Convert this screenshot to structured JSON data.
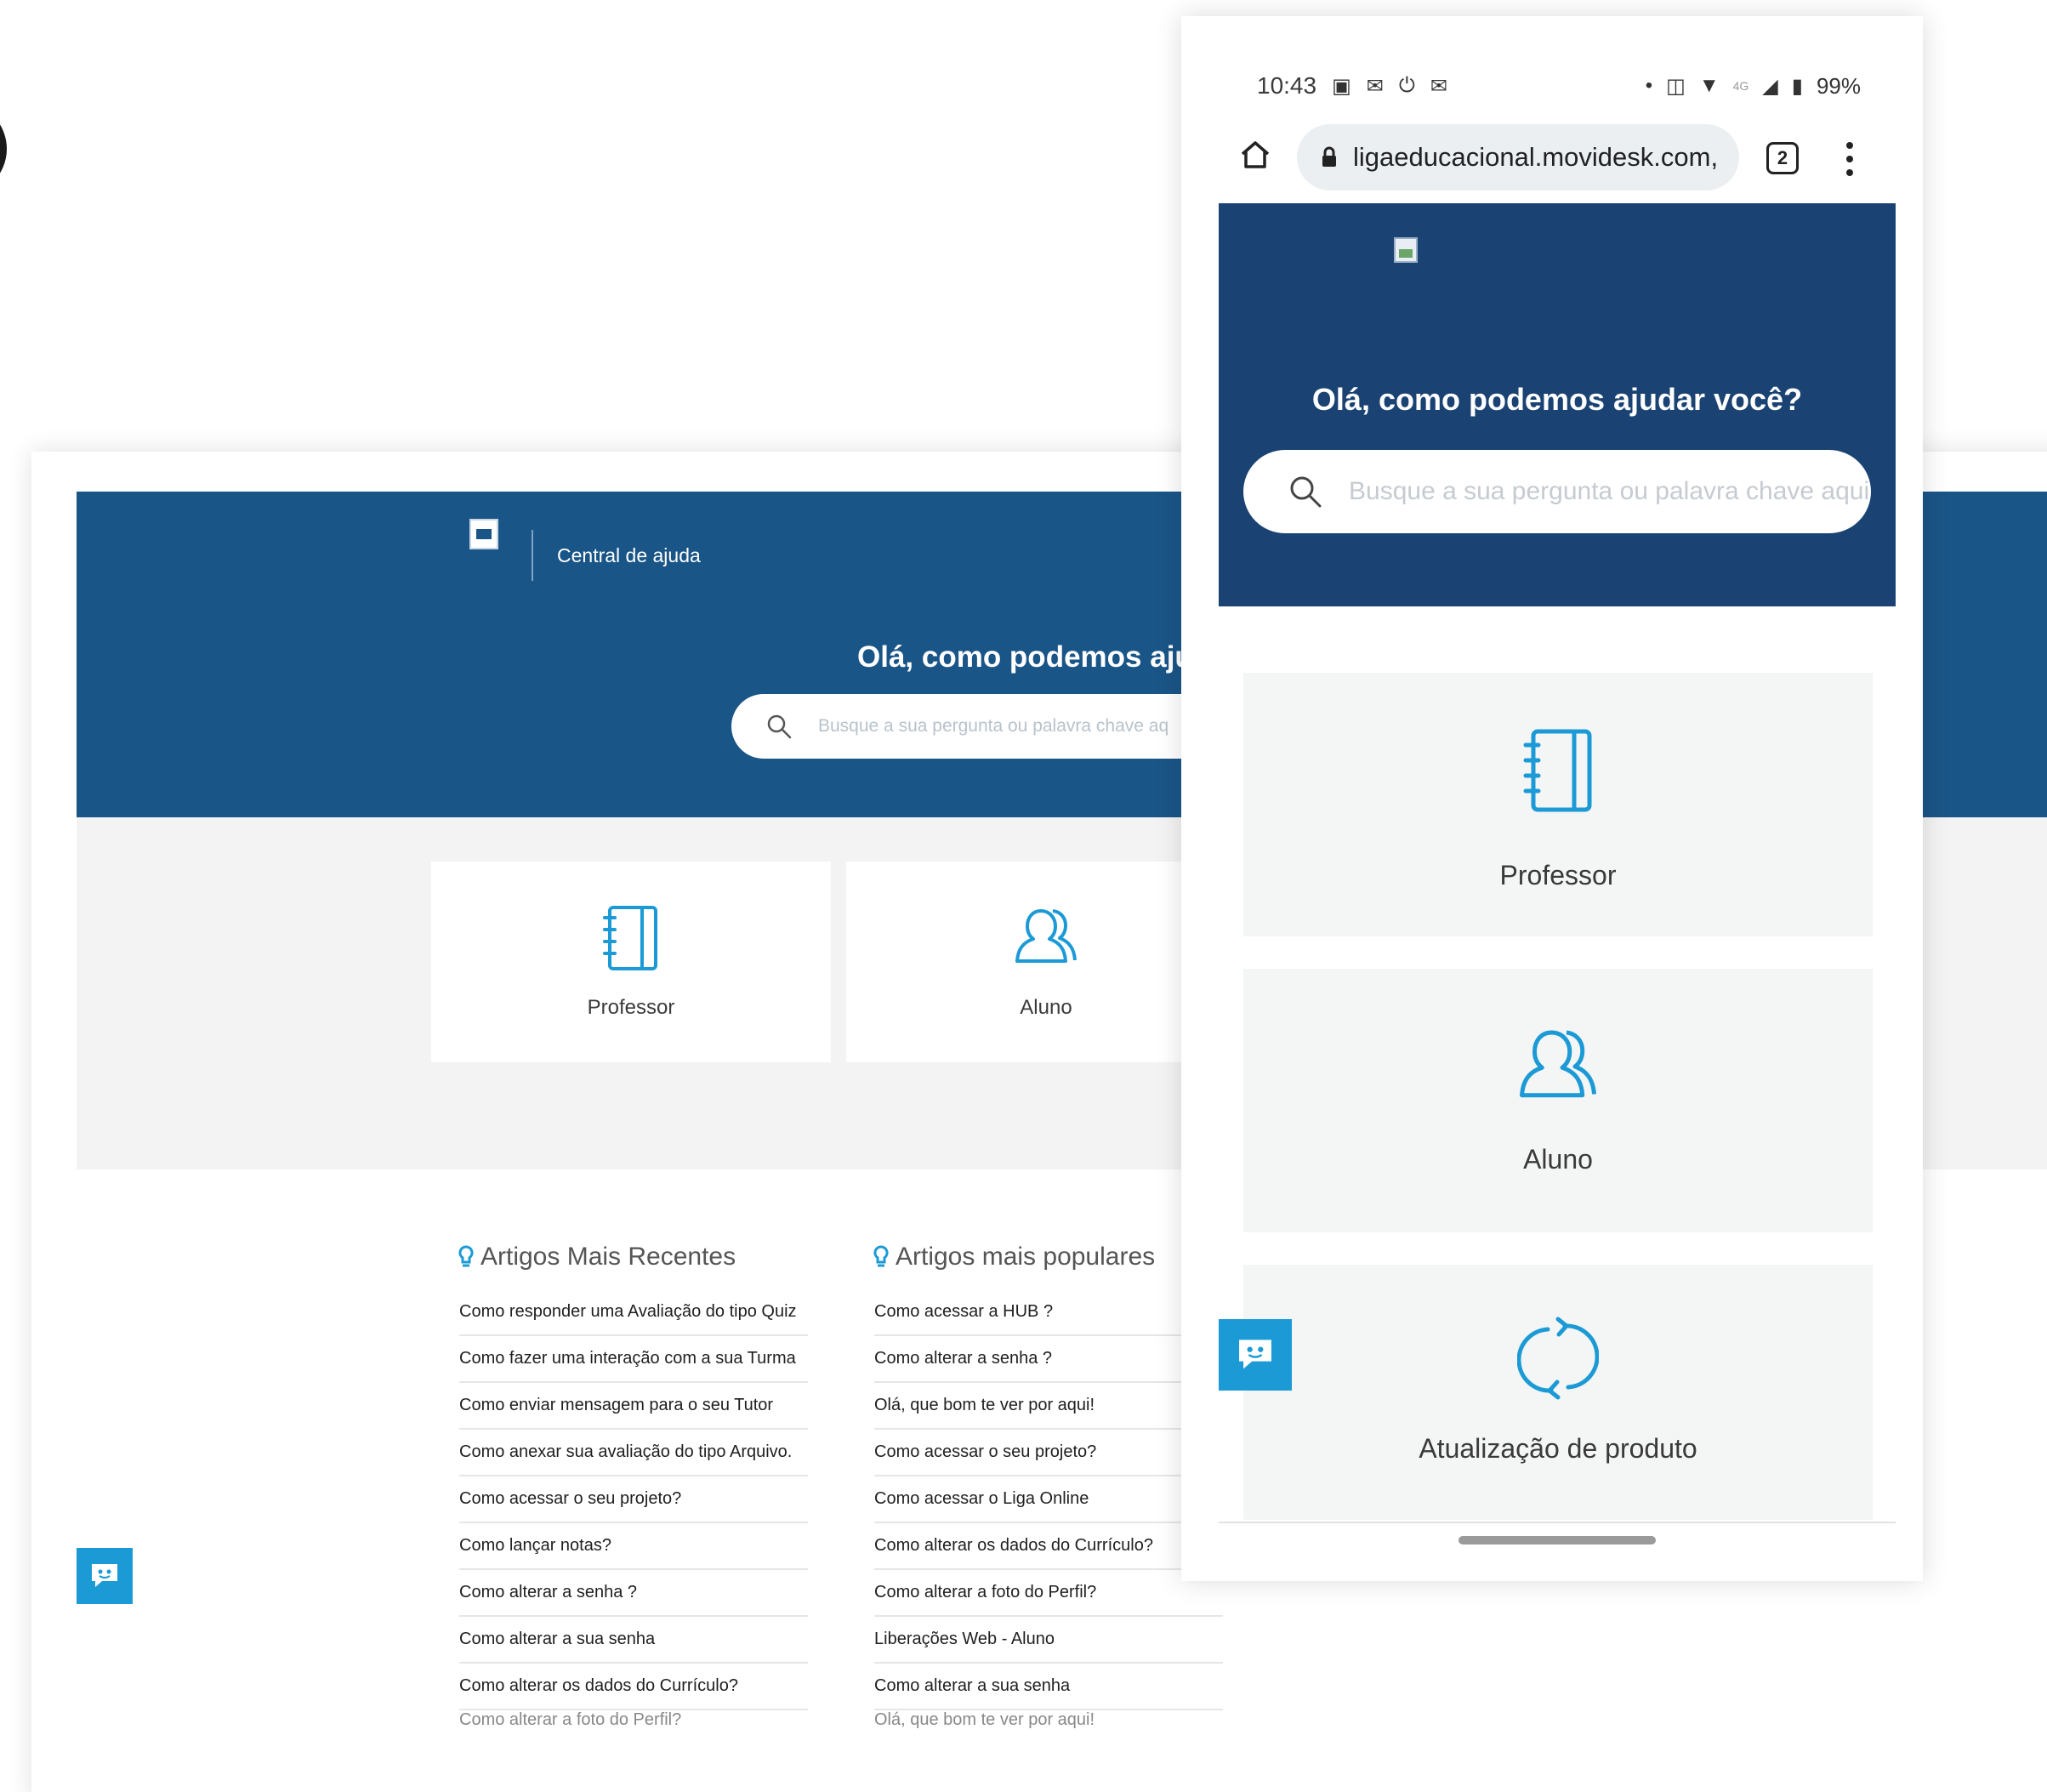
{
  "desktop": {
    "header_label": "Central de ajuda",
    "hero_title": "Olá, como podemos ajudar",
    "search_placeholder": "Busque a sua pergunta ou palavra chave aq",
    "cards": [
      {
        "label": "Professor",
        "icon": "notebook-icon"
      },
      {
        "label": "Aluno",
        "icon": "users-icon"
      }
    ],
    "recent": {
      "title": "Artigos Mais Recentes",
      "items": [
        "Como responder uma Avaliação do tipo Quiz",
        "Como fazer uma interação com a sua Turma",
        "Como enviar mensagem para o seu Tutor",
        "Como anexar sua avaliação do tipo Arquivo.",
        "Como acessar o seu projeto?",
        "Como lançar notas?",
        "Como alterar a senha ?",
        "Como alterar a sua senha",
        "Como alterar os dados do Currículo?",
        "Como alterar a foto do Perfil?"
      ]
    },
    "popular": {
      "title": "Artigos mais populares",
      "items": [
        "Como acessar a HUB ?",
        "Como alterar a senha ?",
        "Olá, que bom te ver por aqui!",
        "Como acessar o seu projeto?",
        "Como acessar o Liga Online",
        "Como alterar os dados do Currículo?",
        "Como alterar a foto do Perfil?",
        "Liberações Web - Aluno",
        "Como alterar a sua senha",
        "Olá, que bom te ver por aqui!"
      ]
    },
    "colors": {
      "hero": "#1a5587",
      "accent": "#1c9ad6"
    }
  },
  "phone": {
    "status": {
      "time": "10:43",
      "battery": "99%",
      "network": "4G"
    },
    "url": "ligaeducacional.movidesk.com,",
    "tab_count": "2",
    "hero_title": "Olá, como podemos ajudar você?",
    "search_placeholder": "Busque a sua pergunta ou palavra chave aqui",
    "cards": [
      {
        "label": "Professor",
        "icon": "notebook-icon"
      },
      {
        "label": "Aluno",
        "icon": "users-icon"
      },
      {
        "label": "Atualização de produto",
        "icon": "refresh-icon"
      }
    ],
    "colors": {
      "hero": "#1a4373"
    }
  }
}
